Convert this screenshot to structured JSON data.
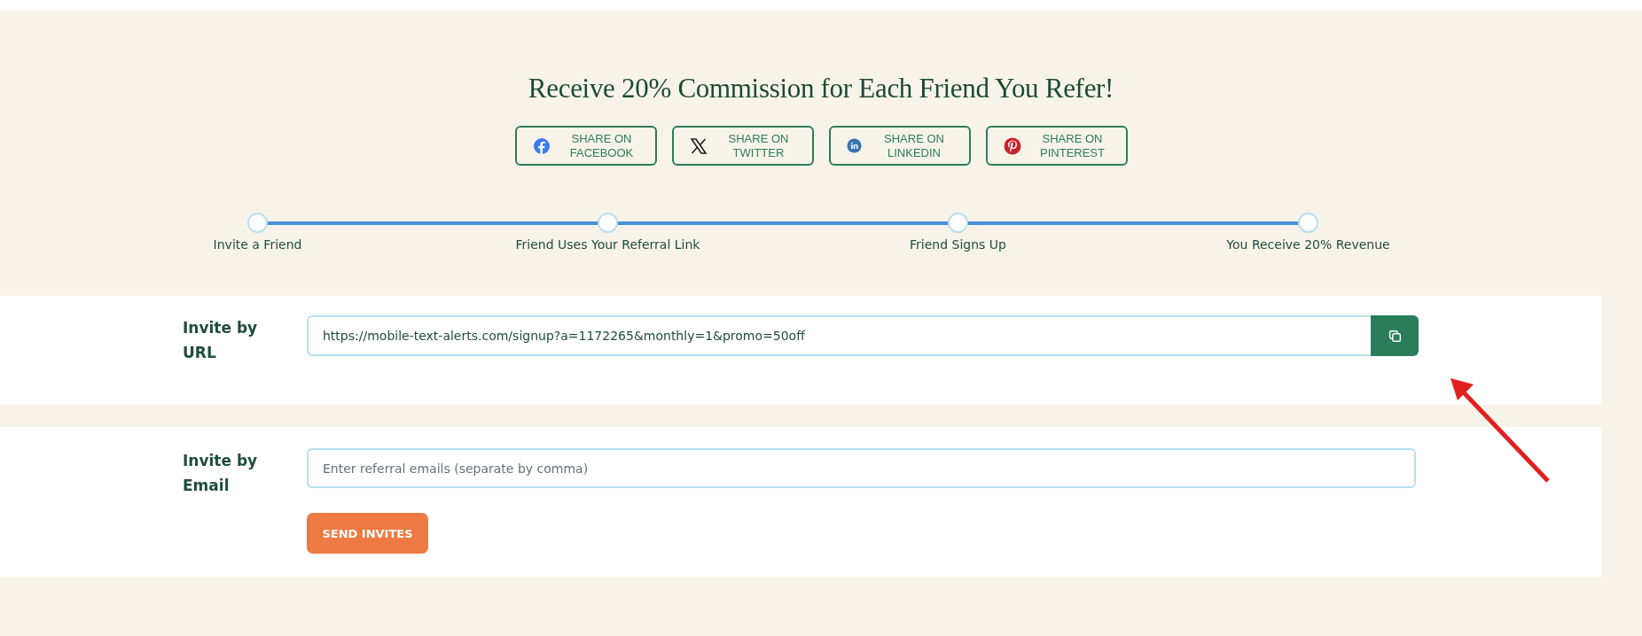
{
  "title": "Receive 20% Commission for Each Friend You Refer!",
  "share_buttons": [
    {
      "kind": "facebook",
      "label": "SHARE ON FACEBOOK"
    },
    {
      "kind": "twitter",
      "label": "SHARE ON TWITTER"
    },
    {
      "kind": "linkedin",
      "label": "SHARE ON LINKEDIN"
    },
    {
      "kind": "pinterest",
      "label": "SHARE ON PINTEREST"
    }
  ],
  "steps": [
    {
      "label": "Invite a Friend"
    },
    {
      "label": "Friend Uses Your Referral Link"
    },
    {
      "label": "Friend Signs Up"
    },
    {
      "label": "You Receive 20% Revenue"
    }
  ],
  "invite_url": {
    "label": "Invite by URL",
    "value": "https://mobile-text-alerts.com/signup?a=1172265&monthly=1&promo=50off"
  },
  "invite_email": {
    "label": "Invite by Email",
    "placeholder": "Enter referral emails (separate by comma)",
    "button": "SEND INVITES"
  }
}
